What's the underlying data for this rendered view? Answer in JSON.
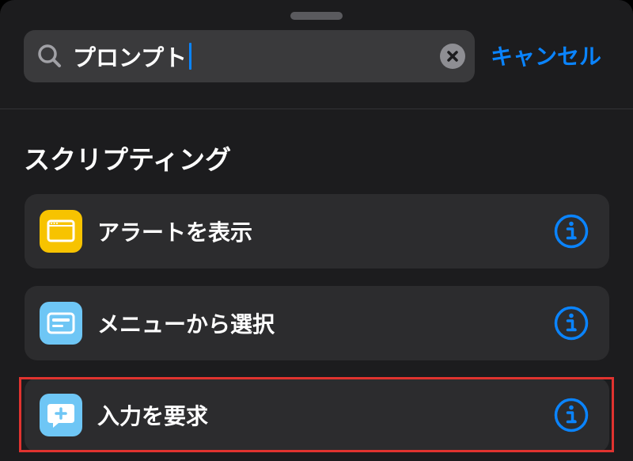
{
  "search": {
    "value": "プロンプト"
  },
  "cancel_label": "キャンセル",
  "section": {
    "title": "スクリプティング"
  },
  "actions": [
    {
      "label": "アラートを表示",
      "icon": "alert-window-icon",
      "icon_color": "#f7c300"
    },
    {
      "label": "メニューから選択",
      "icon": "menu-list-icon",
      "icon_color": "#6ec6f5"
    },
    {
      "label": "入力を要求",
      "icon": "ask-input-bubble-icon",
      "icon_color": "#6ec6f5",
      "highlighted": true
    }
  ],
  "colors": {
    "accent": "#0a84ff",
    "sheet_background": "#1c1c1e",
    "row_background": "#2c2c2e",
    "highlight": "#e0332f"
  }
}
